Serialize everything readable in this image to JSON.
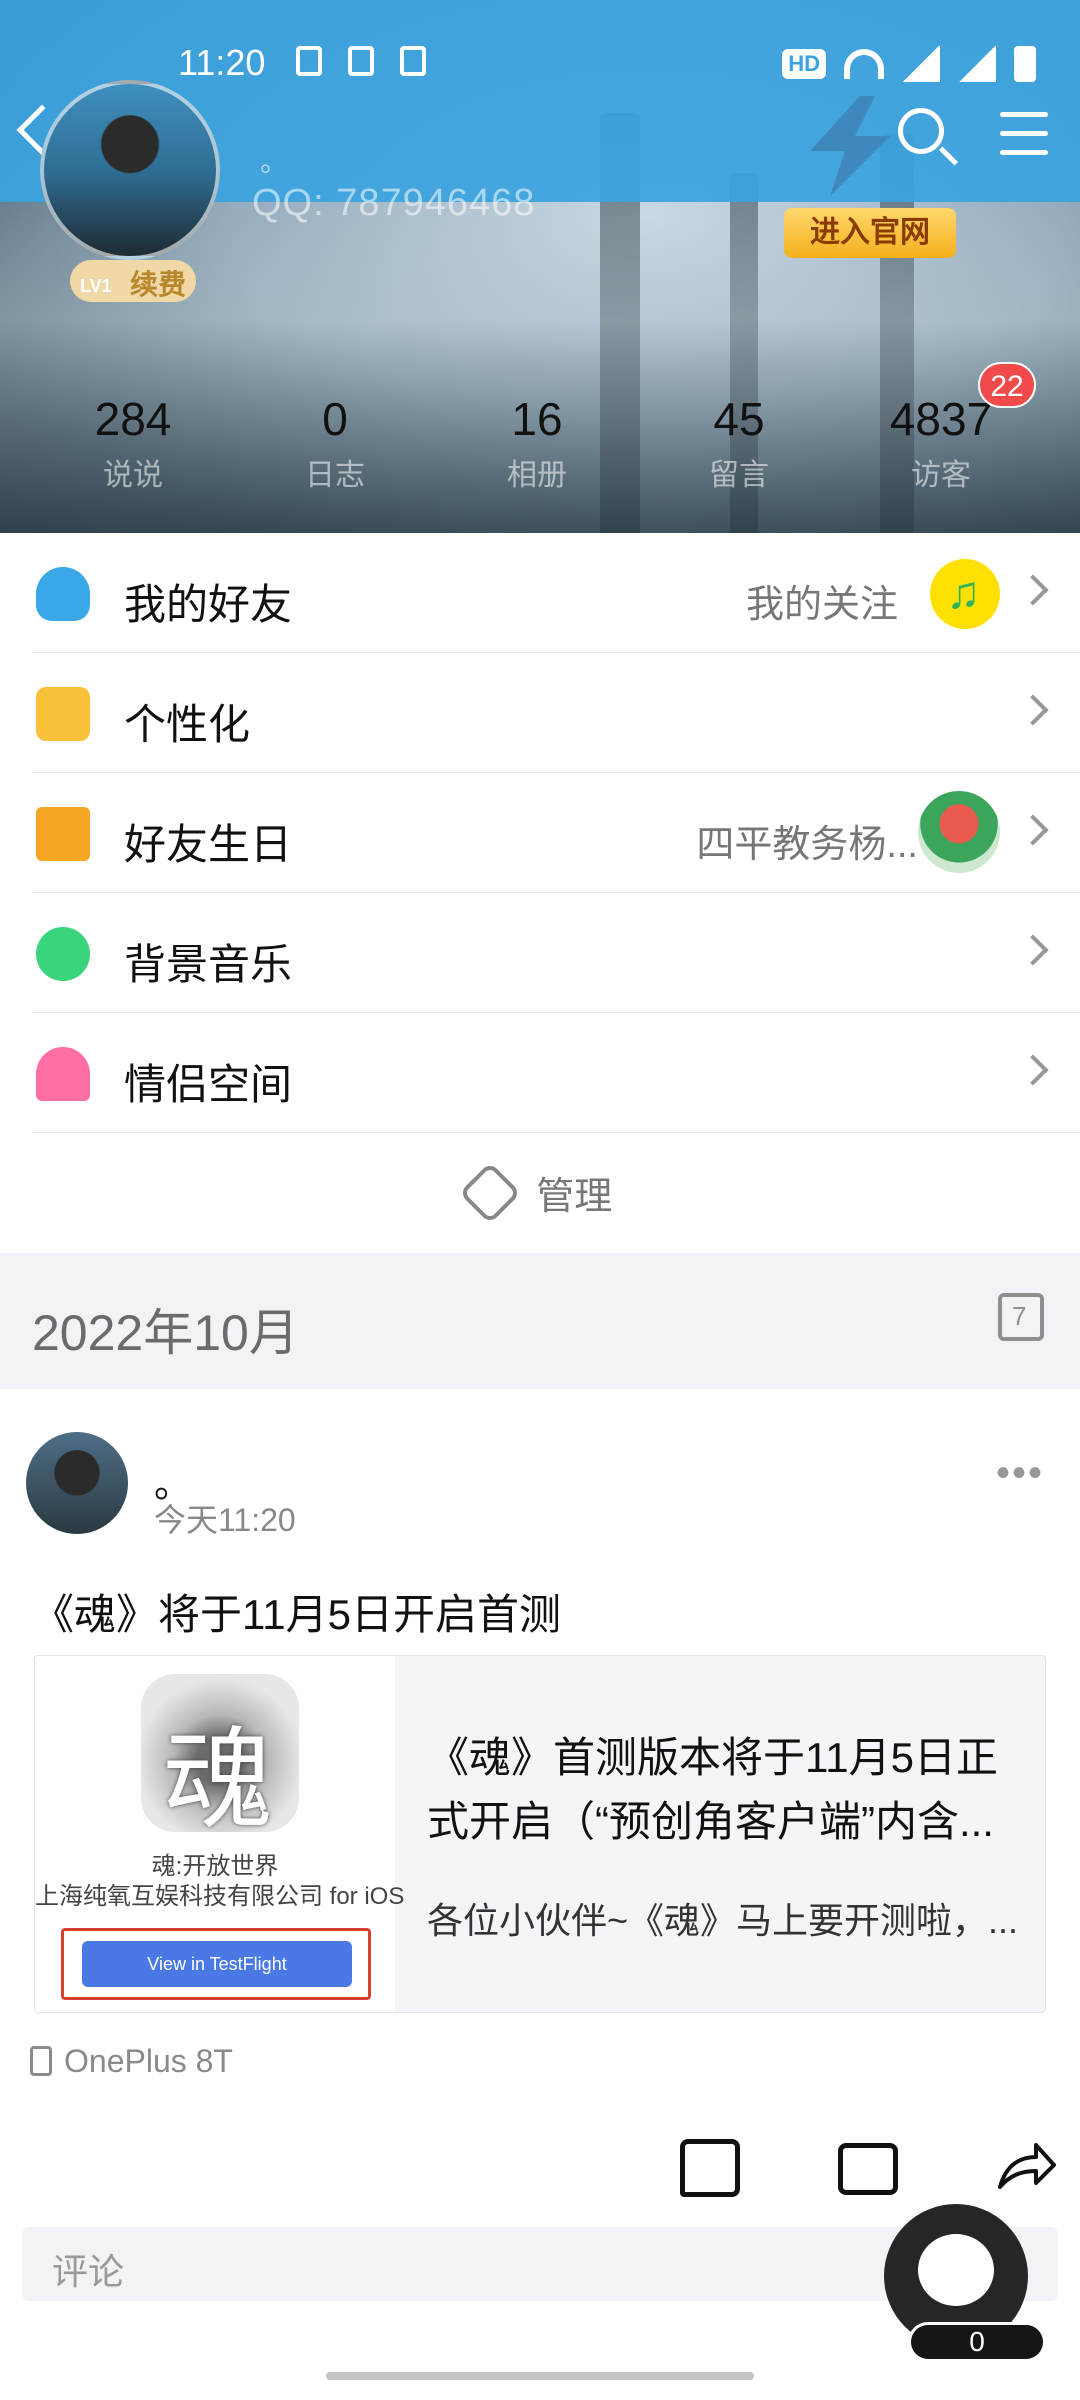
{
  "status_bar": {
    "time": "11:20",
    "hd": "HD",
    "network": "4G"
  },
  "header": {
    "qq_number": "QQ: 787946468",
    "name_dot": "。",
    "level": "LV1",
    "renew_label": "续费",
    "official_site_button": "进入官网",
    "stats": [
      {
        "value": "284",
        "label": "说说"
      },
      {
        "value": "0",
        "label": "日志"
      },
      {
        "value": "16",
        "label": "相册"
      },
      {
        "value": "45",
        "label": "留言"
      },
      {
        "value": "4837",
        "label": "访客"
      }
    ],
    "visitor_badge": "22"
  },
  "menu": {
    "items": [
      {
        "label": "我的好友",
        "right_text": "我的关注"
      },
      {
        "label": "个性化",
        "right_text": ""
      },
      {
        "label": "好友生日",
        "right_text": "四平教务杨..."
      },
      {
        "label": "背景音乐",
        "right_text": ""
      },
      {
        "label": "情侣空间",
        "right_text": ""
      }
    ],
    "manage_label": "管理"
  },
  "date_header": "2022年10月",
  "post": {
    "author": "。",
    "time": "今天11:20",
    "text": "《魂》将于11月5日开启首测",
    "card": {
      "app_icon_char": "魂",
      "app_name": "魂:开放世界",
      "app_company": "上海纯氧互娱科技有限公司 for iOS",
      "tf_button": "View in TestFlight",
      "title": "《魂》首测版本将于11月5日正式开启（“预创角客户端”内含...",
      "description": "各位小伙伴~《魂》马上要开测啦，..."
    },
    "device": "OnePlus 8T",
    "comment_placeholder": "评论"
  },
  "floating_count": "0"
}
